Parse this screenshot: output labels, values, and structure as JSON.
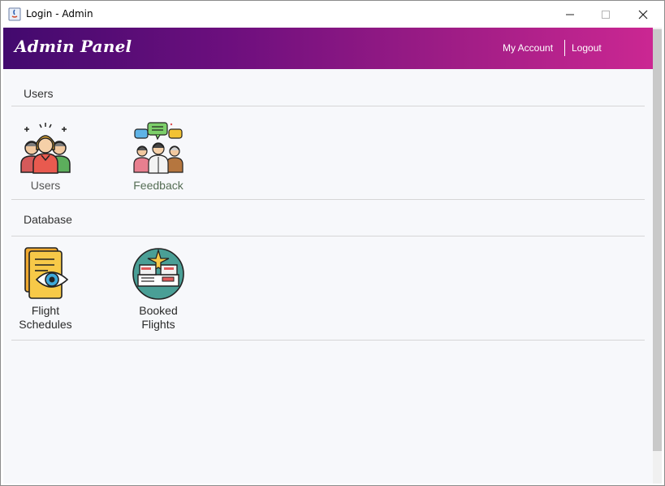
{
  "window": {
    "title": "Login - Admin"
  },
  "header": {
    "brand": "Admin Panel",
    "my_account": "My Account",
    "logout": "Logout"
  },
  "sections": [
    {
      "title": "Users",
      "items": [
        {
          "label": "Users",
          "icon": "users-group-icon",
          "label_color": "#555555"
        },
        {
          "label": "Feedback",
          "icon": "feedback-icon",
          "label_color": "#556e55"
        }
      ]
    },
    {
      "title": "Database",
      "items": [
        {
          "label_line1": "Flight",
          "label_line2": "Schedules",
          "icon": "flight-schedules-icon"
        },
        {
          "label_line1": "Booked",
          "label_line2": "Flights",
          "icon": "booked-flights-icon"
        }
      ]
    }
  ],
  "colors": {
    "header_gradient_start": "#420a6e",
    "header_gradient_end": "#cb2792"
  }
}
